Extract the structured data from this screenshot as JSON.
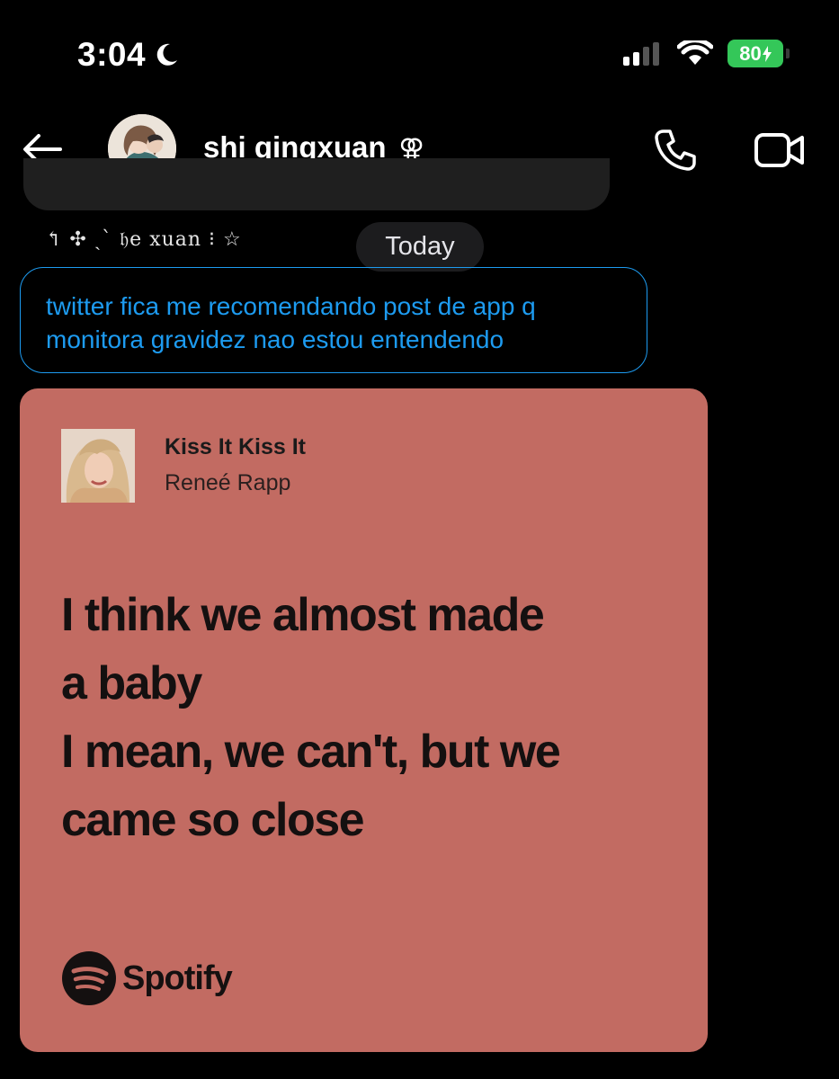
{
  "status_bar": {
    "time": "3:04",
    "battery": "80",
    "battery_color": "#34c759"
  },
  "header": {
    "contact_name": "shi qingxuan",
    "contact_symbol": "⚢",
    "icons": [
      "back-arrow-icon",
      "phone-icon",
      "video-camera-icon"
    ]
  },
  "conversation": {
    "reply_label": "↰ ✣ ˏˋ 𝔥e xuan ⁝ ☆",
    "date_divider": "Today",
    "message_text": "twitter fica me recomendando post de app q monitora gravidez nao estou entendendo",
    "message_color": "#1d9bf0"
  },
  "spotify_card": {
    "song_title": "Kiss It Kiss It",
    "artist": "Reneé Rapp",
    "lyrics": [
      "I think we almost made",
      "a baby",
      "I mean, we can't, but we",
      "came so close"
    ],
    "brand": "Spotify",
    "background_color": "#c26b62"
  }
}
